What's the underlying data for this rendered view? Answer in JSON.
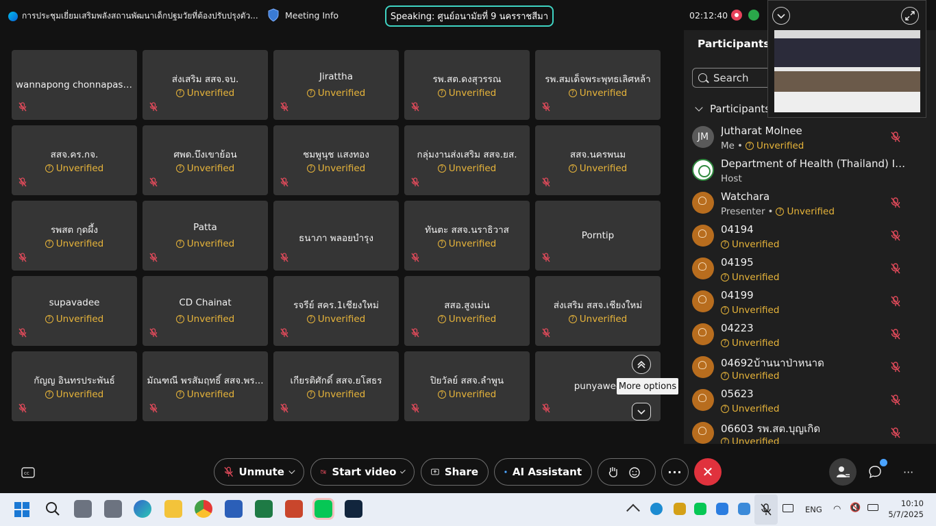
{
  "topbar": {
    "title": "การประชุมเยี่ยมเสริมพลังสถานพัฒนาเด็กปฐมวัยที่ต้องปรับปรุงตัว...",
    "meeting_info": "Meeting Info",
    "speaking": "Speaking: ศูนย์อนามัยที่ 9 นครราชสีมา",
    "timer": "02:12:40"
  },
  "tiles": [
    {
      "name": "wannapong chonnapasa...",
      "status": ""
    },
    {
      "name": "ส่งเสริม สสจ.จบ.",
      "status": "Unverified"
    },
    {
      "name": "Jirattha",
      "status": "Unverified"
    },
    {
      "name": "รพ.สต.ดงสุวรรณ",
      "status": "Unverified"
    },
    {
      "name": "รพ.สมเด็จพระพุทธเลิศหล้า",
      "status": "Unverified"
    },
    {
      "name": "สสจ.คร.กจ.",
      "status": "Unverified"
    },
    {
      "name": "ศพด.บึงเขาย้อน",
      "status": "Unverified"
    },
    {
      "name": "ชมพูนุช แสงทอง",
      "status": "Unverified"
    },
    {
      "name": "กลุ่มงานส่งเสริม สสจ.ยส.",
      "status": "Unverified"
    },
    {
      "name": "สสจ.นครพนม",
      "status": "Unverified"
    },
    {
      "name": "รพสต กุดผึ้ง",
      "status": "Unverified"
    },
    {
      "name": "Patta",
      "status": "Unverified"
    },
    {
      "name": "ธนาภา พลอยบำรุง",
      "status": ""
    },
    {
      "name": "ทันตะ สสจ.นราธิวาส",
      "status": "Unverified"
    },
    {
      "name": "Porntip",
      "status": ""
    },
    {
      "name": "supavadee",
      "status": "Unverified"
    },
    {
      "name": "CD Chainat",
      "status": "Unverified"
    },
    {
      "name": "รจรีย์ สคร.1เชียงใหม่",
      "status": "Unverified"
    },
    {
      "name": "สสอ.สูงเม่น",
      "status": "Unverified"
    },
    {
      "name": "ส่งเสริม สสจ.เชียงใหม่",
      "status": "Unverified"
    },
    {
      "name": "กัญญ อินทรประพันธ์",
      "status": "Unverified"
    },
    {
      "name": "มัณฑณี พรสัมฤทธิ์ สสจ.พร...",
      "status": "Unverified"
    },
    {
      "name": "เกียรติศักดิ์ สสจ.ยโสธร",
      "status": "Unverified"
    },
    {
      "name": "ปิยวัลย์ สสจ.ลำพูน",
      "status": "Unverified"
    },
    {
      "name": "punyawee",
      "status": ""
    }
  ],
  "tooltip": "More options",
  "sidebar": {
    "title": "Participants (4",
    "search_placeholder": "Search",
    "section": "Participants",
    "participants": [
      {
        "name": "Jutharat Molnee",
        "role": "Me",
        "status": "Unverified",
        "avatar": "JM",
        "type": "initials"
      },
      {
        "name": "Department of Health (Thailand) ID...",
        "role": "Host",
        "status": "",
        "avatar": "",
        "type": "logo"
      },
      {
        "name": "Watchara",
        "role": "Presenter",
        "status": "Unverified",
        "avatar": "",
        "type": "user"
      },
      {
        "name": "04194",
        "role": "",
        "status": "Unverified",
        "avatar": "",
        "type": "user"
      },
      {
        "name": "04195",
        "role": "",
        "status": "Unverified",
        "avatar": "",
        "type": "user"
      },
      {
        "name": "04199",
        "role": "",
        "status": "Unverified",
        "avatar": "",
        "type": "user"
      },
      {
        "name": "04223",
        "role": "",
        "status": "Unverified",
        "avatar": "",
        "type": "user"
      },
      {
        "name": "04692บ้านนาป่าหนาด",
        "role": "",
        "status": "Unverified",
        "avatar": "",
        "type": "user"
      },
      {
        "name": "05623",
        "role": "",
        "status": "Unverified",
        "avatar": "",
        "type": "user"
      },
      {
        "name": "06603 รพ.สต.บุญเกิด",
        "role": "",
        "status": "Unverified",
        "avatar": "",
        "type": "user"
      }
    ]
  },
  "controls": {
    "unmute": "Unmute",
    "start_video": "Start video",
    "share": "Share",
    "ai_assistant": "AI Assistant"
  },
  "taskbar": {
    "lang": "ENG",
    "time": "10:10",
    "date": "5/7/2025"
  },
  "colors": {
    "unverified": "#e8b53a",
    "speaking_border": "#3fd4c3",
    "end_call": "#e0323d"
  }
}
